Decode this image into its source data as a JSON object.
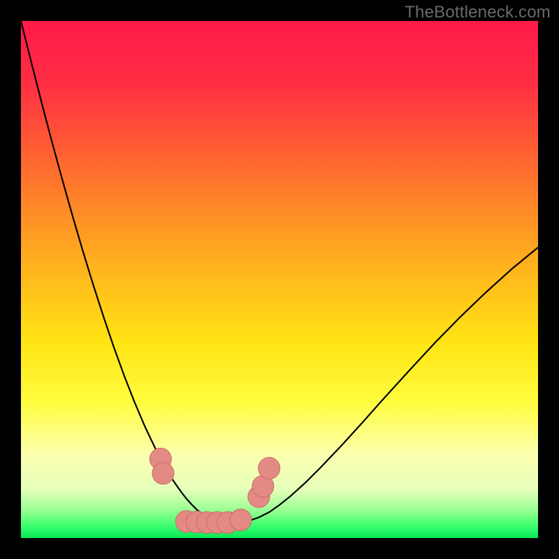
{
  "watermark": {
    "text": "TheBottleneck.com"
  },
  "colors": {
    "background": "#000000",
    "gradient_stops": [
      {
        "offset": 0.0,
        "color": "#ff1a4a"
      },
      {
        "offset": 0.12,
        "color": "#ff2e43"
      },
      {
        "offset": 0.28,
        "color": "#ff6a2f"
      },
      {
        "offset": 0.45,
        "color": "#ffaa1f"
      },
      {
        "offset": 0.62,
        "color": "#ffe413"
      },
      {
        "offset": 0.74,
        "color": "#fffd40"
      },
      {
        "offset": 0.84,
        "color": "#fbffb0"
      },
      {
        "offset": 0.905,
        "color": "#e6ffba"
      },
      {
        "offset": 0.945,
        "color": "#9cff95"
      },
      {
        "offset": 0.975,
        "color": "#3fff6e"
      },
      {
        "offset": 1.0,
        "color": "#06e858"
      }
    ],
    "curve": "#000000",
    "marker_fill": "#e48a85",
    "marker_stroke": "#c76c67"
  },
  "chart_data": {
    "type": "line",
    "title": "",
    "xlabel": "",
    "ylabel": "",
    "xlim": [
      0,
      100
    ],
    "ylim": [
      0,
      100
    ],
    "x": [
      0,
      2,
      4,
      6,
      8,
      10,
      12,
      14,
      16,
      18,
      20,
      22,
      24,
      26,
      27,
      28,
      29,
      30,
      31,
      32,
      33,
      34,
      35,
      36,
      37,
      38,
      40,
      42,
      44,
      46,
      48,
      50,
      52,
      55,
      58,
      62,
      66,
      70,
      75,
      80,
      85,
      90,
      95,
      100
    ],
    "values": [
      100,
      92.0,
      84.2,
      76.6,
      69.3,
      62.2,
      55.4,
      48.9,
      42.7,
      36.8,
      31.3,
      26.2,
      21.5,
      17.3,
      15.3,
      13.5,
      11.8,
      10.3,
      8.9,
      7.6,
      6.5,
      5.5,
      4.7,
      4.0,
      3.5,
      3.2,
      3.0,
      3.0,
      3.3,
      4.0,
      5.0,
      6.4,
      8.0,
      10.7,
      13.7,
      17.9,
      22.3,
      26.8,
      32.3,
      37.7,
      42.8,
      47.6,
      52.1,
      56.2
    ],
    "markers": [
      {
        "x": 27.0,
        "y": 15.3
      },
      {
        "x": 27.5,
        "y": 12.5
      },
      {
        "x": 32.0,
        "y": 3.2
      },
      {
        "x": 34.0,
        "y": 3.1
      },
      {
        "x": 36.0,
        "y": 3.0
      },
      {
        "x": 38.0,
        "y": 3.0
      },
      {
        "x": 40.0,
        "y": 3.0
      },
      {
        "x": 42.5,
        "y": 3.5
      },
      {
        "x": 46.0,
        "y": 8.0
      },
      {
        "x": 46.8,
        "y": 10.0
      },
      {
        "x": 48.0,
        "y": 13.5
      }
    ],
    "marker_radius_y": 2.1
  }
}
